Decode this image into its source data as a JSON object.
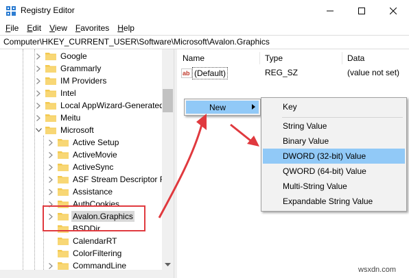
{
  "window": {
    "title": "Registry Editor",
    "app_icon": "registry-icon",
    "controls": {
      "minimize": "minimize-icon",
      "maximize": "maximize-icon",
      "close": "close-icon"
    }
  },
  "menubar": {
    "items": [
      {
        "first": "F",
        "rest": "ile"
      },
      {
        "first": "E",
        "rest": "dit"
      },
      {
        "first": "V",
        "rest": "iew"
      },
      {
        "first": "F",
        "rest": "avorites"
      },
      {
        "first": "H",
        "rest": "elp"
      }
    ]
  },
  "address": "Computer\\HKEY_CURRENT_USER\\Software\\Microsoft\\Avalon.Graphics",
  "tree": {
    "items": [
      {
        "label": "Google",
        "level": 1,
        "expandable": true
      },
      {
        "label": "Grammarly",
        "level": 1,
        "expandable": true
      },
      {
        "label": "IM Providers",
        "level": 1,
        "expandable": true
      },
      {
        "label": "Intel",
        "level": 1,
        "expandable": true
      },
      {
        "label": "Local AppWizard-Generated",
        "level": 1,
        "expandable": true
      },
      {
        "label": "Meitu",
        "level": 1,
        "expandable": true
      },
      {
        "label": "Microsoft",
        "level": 1,
        "expandable": true,
        "expanded": true
      },
      {
        "label": "Active Setup",
        "level": 2,
        "expandable": true
      },
      {
        "label": "ActiveMovie",
        "level": 2,
        "expandable": true
      },
      {
        "label": "ActiveSync",
        "level": 2,
        "expandable": true
      },
      {
        "label": "ASF Stream Descriptor Fi",
        "level": 2,
        "expandable": true
      },
      {
        "label": "Assistance",
        "level": 2,
        "expandable": true
      },
      {
        "label": "AuthCookies",
        "level": 2,
        "expandable": true
      },
      {
        "label": "Avalon.Graphics",
        "level": 2,
        "expandable": true,
        "selected": true
      },
      {
        "label": "BSDDir",
        "level": 2,
        "expandable": false
      },
      {
        "label": "CalendarRT",
        "level": 2,
        "expandable": false
      },
      {
        "label": "ColorFiltering",
        "level": 2,
        "expandable": false
      },
      {
        "label": "CommandLine",
        "level": 2,
        "expandable": true
      }
    ]
  },
  "values": {
    "columns": {
      "name": "Name",
      "type": "Type",
      "data": "Data"
    },
    "rows": [
      {
        "name": "(Default)",
        "type": "REG_SZ",
        "data": "(value not set)",
        "icon": "string-value-icon"
      }
    ]
  },
  "context_menu": {
    "new_label": "New",
    "submenu": [
      "Key",
      "String Value",
      "Binary Value",
      "DWORD (32-bit) Value",
      "QWORD (64-bit) Value",
      "Multi-String Value",
      "Expandable String Value"
    ],
    "highlighted": "DWORD (32-bit) Value"
  },
  "annotations": {
    "color": "#e0393e"
  },
  "watermark": "wsxdn.com",
  "colors": {
    "menu_highlight": "#91c9f7",
    "selection": "#d9d9d9",
    "folder": "#f3c94f",
    "annotation": "#e0393e"
  }
}
